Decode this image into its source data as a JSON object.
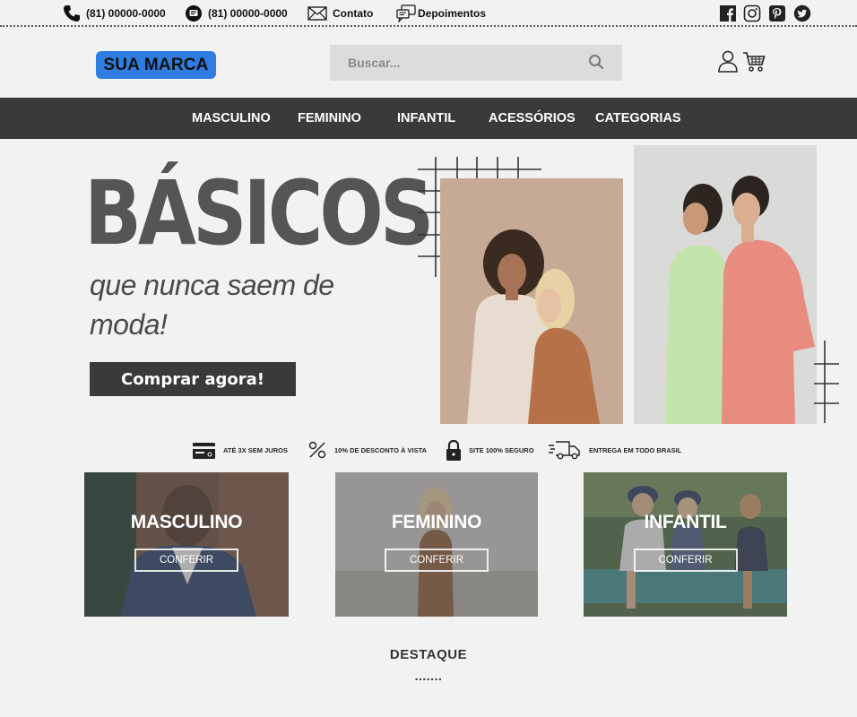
{
  "topbar": {
    "phone": "(81) 00000-0000",
    "whatsapp": "(81) 00000-0000",
    "contact": "Contato",
    "testimonials": "Depoimentos",
    "social": [
      "facebook-icon",
      "instagram-icon",
      "pinterest-icon",
      "twitter-icon"
    ]
  },
  "header": {
    "logo": "SUA MARCA",
    "search_placeholder": "Buscar..."
  },
  "nav": [
    "MASCULINO",
    "FEMININO",
    "INFANTIL",
    "ACESSÓRIOS",
    "CATEGORIAS"
  ],
  "hero": {
    "title": "BÁSICOS",
    "subtitle": "que nunca saem de moda!",
    "cta": "Comprar agora!"
  },
  "benefits": [
    {
      "icon": "credit-card-icon",
      "label": "ATÉ 3X SEM JUROS"
    },
    {
      "icon": "percent-icon",
      "label": "10% DE DESCONTO À VISTA"
    },
    {
      "icon": "lock-icon",
      "label": "SITE 100% SEGURO"
    },
    {
      "icon": "truck-icon",
      "label": "ENTREGA EM TODO BRASIL"
    }
  ],
  "categories": [
    {
      "title": "MASCULINO",
      "button": "CONFERIR"
    },
    {
      "title": "FEMININO",
      "button": "CONFERIR"
    },
    {
      "title": "INFANTIL",
      "button": "CONFERIR"
    }
  ],
  "highlight": {
    "title": "DESTAQUE",
    "dots": "......."
  },
  "colors": {
    "brand": "#2f7de1",
    "nav_bg": "#3a3a3a",
    "page_bg": "#f2f2f2"
  }
}
